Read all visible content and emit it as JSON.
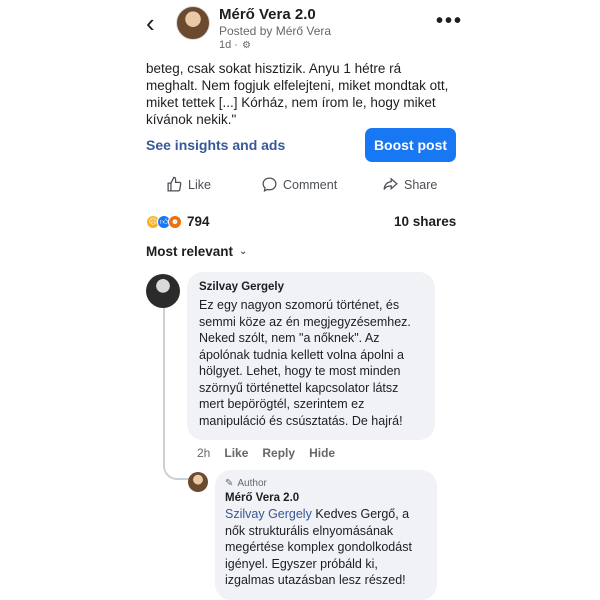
{
  "header": {
    "back_icon": "chevron-left-icon",
    "page_name": "Mérő Vera 2.0",
    "posted_by": "Posted by Mérő Vera",
    "time": "1d ·",
    "more_icon": "more-dots-icon"
  },
  "post": {
    "text": "beteg, csak sokat hisztizik. Anyu 1 hétre rá\nmeghalt. Nem fogjuk elfelejteni, miket mondtak ott,\nmiket tettek [...] Kórház, nem írom le, hogy miket\nkívánok nekik.\""
  },
  "promo": {
    "insights_label": "See insights and ads",
    "boost_label": "Boost post",
    "accent": "#1877f2"
  },
  "actions": {
    "like": "Like",
    "comment": "Comment",
    "share": "Share"
  },
  "stats": {
    "reaction_count": "794",
    "shares": "10 shares"
  },
  "sort": {
    "label": "Most relevant"
  },
  "comment": {
    "author": "Szilvay Gergely",
    "text": "Ez egy nagyon szomorú történet, és\nsemmi köze az én megjegyzésemhez.\nNeked szólt, nem \"a nőknek\". Az\nápolónak tudnia kellett volna ápolni a\nhölgyet. Lehet, hogy te most minden\nszörnyű történettel kapcsolator látsz\nmert bepörögtél, szerintem ez\nmanipuláció és csúsztatás. De hajrá!",
    "time": "2h",
    "like": "Like",
    "reply": "Reply",
    "hide": "Hide"
  },
  "reply": {
    "badge": "Author",
    "author": "Mérő Vera 2.0",
    "mention": "Szilvay Gergely",
    "text": " Kedves Gergő, a\nnők strukturális elnyomásának\nmegértése komplex gondolkodást\nigényel. Egyszer próbáld ki,\nizgalmas utazásban lesz részed!"
  }
}
